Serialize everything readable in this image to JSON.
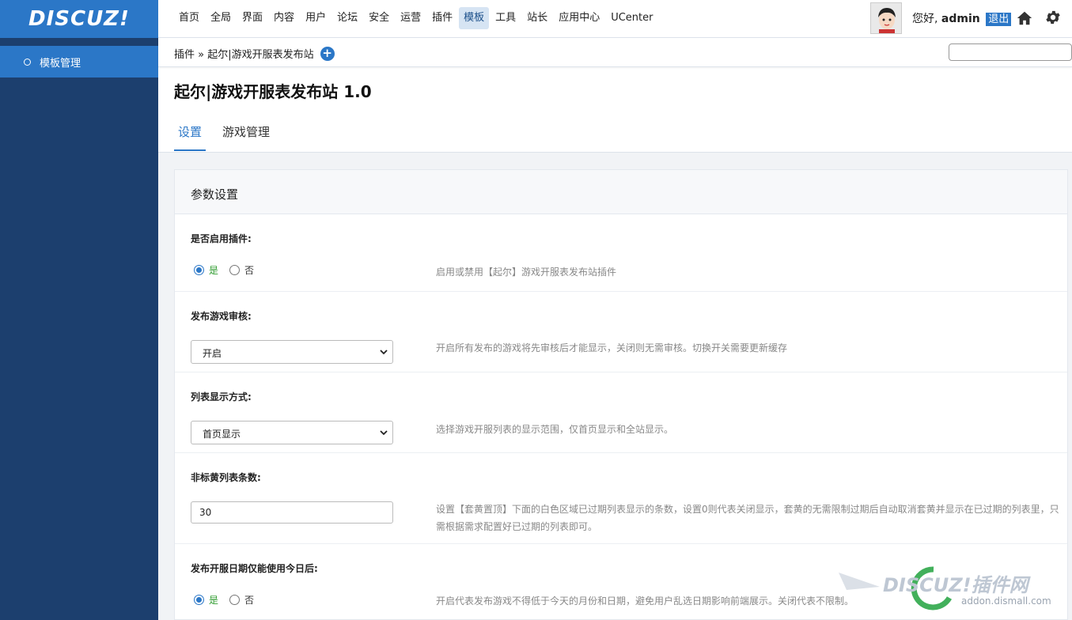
{
  "brand": {
    "logo_text": "DISCUZ!"
  },
  "sidebar": {
    "items": [
      {
        "label": "模板管理"
      }
    ]
  },
  "topnav": {
    "items": [
      "首页",
      "全局",
      "界面",
      "内容",
      "用户",
      "论坛",
      "安全",
      "运营",
      "插件",
      "模板",
      "工具",
      "站长",
      "应用中心",
      "UCenter"
    ],
    "active": "模板"
  },
  "user": {
    "greeting": "您好,",
    "name": "admin",
    "logout": "退出"
  },
  "breadcrumb": {
    "text": "插件 » 起尔|游戏开服表发布站"
  },
  "page": {
    "title": "起尔|游戏开服表发布站 1.0",
    "tabs": [
      "设置",
      "游戏管理"
    ]
  },
  "panel": {
    "title": "参数设置",
    "settings": [
      {
        "label": "是否启用插件:",
        "yes": "是",
        "no": "否",
        "desc": "启用或禁用【起尔】游戏开服表发布站插件"
      },
      {
        "label": "发布游戏审核:",
        "value": "开启",
        "desc": "开启所有发布的游戏将先审核后才能显示，关闭则无需审核。切换开关需要更新缓存"
      },
      {
        "label": "列表显示方式:",
        "value": "首页显示",
        "desc": "选择游戏开服列表的显示范围，仅首页显示和全站显示。"
      },
      {
        "label": "非标黄列表条数:",
        "value": "30",
        "desc_line1": "设置【套黄置顶】下面的白色区域已过期列表显示的条数，设置0则代表关闭显示，套黄的无需限制过期后自动取消套黄并显示在已过期的列表里，只",
        "desc_line2": "需根据需求配置好已过期的列表即可。"
      },
      {
        "label": "发布开服日期仅能使用今日后:",
        "yes": "是",
        "no": "否",
        "desc": "开启代表发布游戏不得低于今天的月份和日期，避免用户乱选日期影响前端展示。关闭代表不限制。"
      }
    ]
  },
  "watermark": {
    "line1": "DISCUZ!插件网",
    "line2": "addon.dismall.com"
  },
  "colors": {
    "sidebar": "#1c3f6e",
    "accent": "#2b77c7",
    "yes_green": "#2e9b2e"
  }
}
